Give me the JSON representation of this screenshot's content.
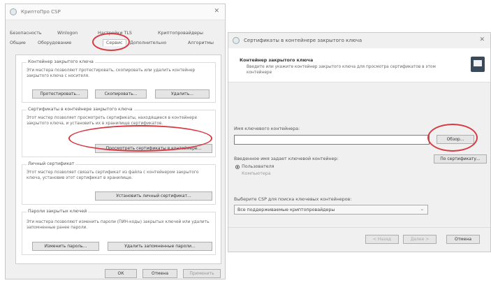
{
  "left_dialog": {
    "title": "КриптоПро CSP",
    "tabs_row1": [
      "Безопасность",
      "Winlogon",
      "Настройки TLS",
      "Криптопровайдеры"
    ],
    "tabs_row2": [
      "Общие",
      "Оборудование",
      "Сервис",
      "Дополнительно",
      "Алгоритмы"
    ],
    "group_container": {
      "title": "Контейнер закрытого ключа",
      "text": "Эти мастера позволяют протестировать, скопировать или удалить контейнер закрытого ключа с носителя.",
      "btn_test": "Протестировать...",
      "btn_copy": "Скопировать...",
      "btn_delete": "Удалить..."
    },
    "group_certs": {
      "title": "Сертификаты в контейнере закрытого ключа",
      "text": "Этот мастер позволяет просмотреть сертификаты, находящиеся в контейнере закрытого ключа, и установить их в хранилище сертификатов.",
      "btn_view": "Просмотреть сертификаты в контейнере..."
    },
    "group_personal": {
      "title": "Личный сертификат",
      "text": "Этот мастер позволяет связать сертификат из файла с контейнером закрытого ключа, установив этот сертификат в хранилище.",
      "btn_install": "Установить личный сертификат..."
    },
    "group_passwords": {
      "title": "Пароли закрытых ключей",
      "text": "Эти мастера позволяют изменить пароли (ПИН-коды) закрытых ключей или удалить запомненные ранее пароли.",
      "btn_change": "Изменить пароль...",
      "btn_delete_saved": "Удалить запомненные пароли..."
    },
    "footer": {
      "ok": "ОК",
      "cancel": "Отмена",
      "apply": "Применить"
    }
  },
  "right_dialog": {
    "title": "Сертификаты в контейнере закрытого ключа",
    "close": "✕",
    "header_title": "Контейнер закрытого ключа",
    "header_text": "Введите или укажите контейнер закрытого ключа для просмотра сертификатов в этом контейнере",
    "container_label": "Имя ключевого контейнера:",
    "container_value": "",
    "btn_browse": "Обзор...",
    "btn_by_cert": "По сертификату...",
    "entered_name_label": "Введенное имя задает ключевой контейнер:",
    "radio_user": "Пользователя",
    "radio_computer": "Компьютера",
    "csp_label": "Выберите CSP для поиска ключевых контейнеров:",
    "csp_value": "Все поддерживаемые криптопровайдеры",
    "btn_back": "< Назад",
    "btn_next": "Далее >",
    "btn_cancel": "Отмена"
  },
  "annotations": {
    "highlight_color": "#d63a45"
  }
}
